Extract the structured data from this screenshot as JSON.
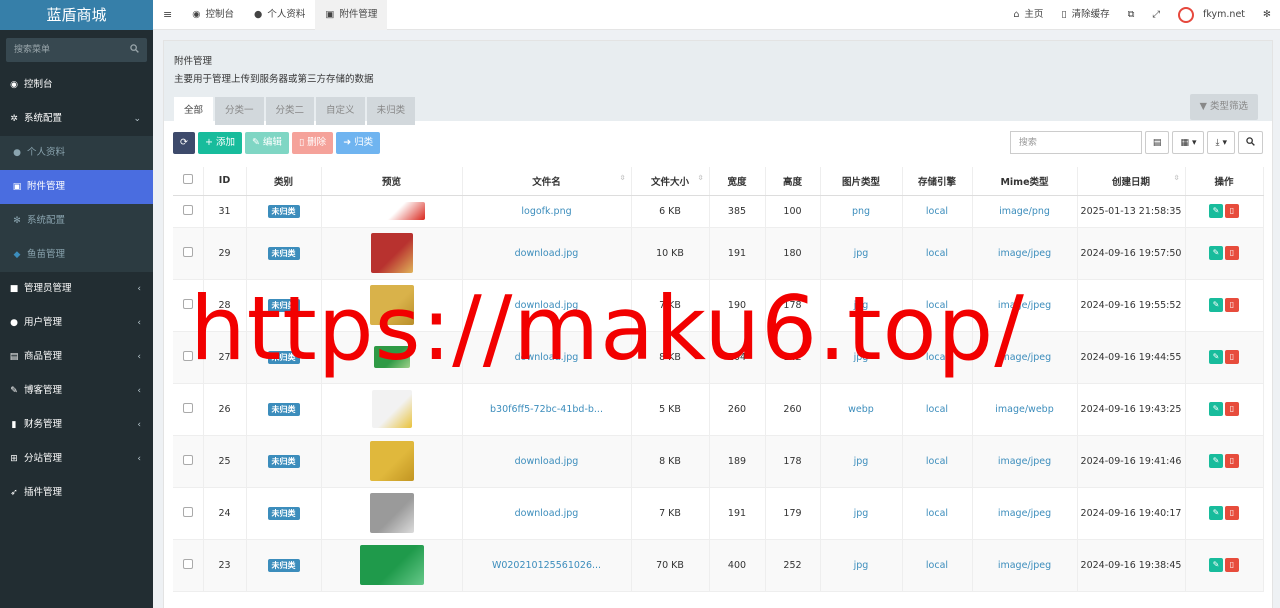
{
  "app": {
    "title": "蓝盾商城"
  },
  "sidebar": {
    "search_placeholder": "搜索菜单",
    "items": [
      {
        "label": "控制台",
        "icon": "dashboard-icon"
      },
      {
        "label": "系统配置",
        "icon": "cogs-icon",
        "expanded": true
      },
      {
        "label": "个人资料",
        "icon": "user-icon",
        "sub": true
      },
      {
        "label": "附件管理",
        "icon": "file-image-icon",
        "sub": true,
        "active": true
      },
      {
        "label": "系统配置",
        "icon": "gear-icon",
        "sub": true
      },
      {
        "label": "鱼苗管理",
        "icon": "fish-icon",
        "sub": true
      },
      {
        "label": "管理员管理",
        "icon": "group-icon"
      },
      {
        "label": "用户管理",
        "icon": "user-icon"
      },
      {
        "label": "商品管理",
        "icon": "shop-icon"
      },
      {
        "label": "博客管理",
        "icon": "blog-icon"
      },
      {
        "label": "财务管理",
        "icon": "book-icon"
      },
      {
        "label": "分站管理",
        "icon": "sitemap-icon"
      },
      {
        "label": "插件管理",
        "icon": "rocket-icon"
      }
    ]
  },
  "topbar": {
    "tabs": [
      {
        "label": "控制台",
        "icon": "dashboard-icon"
      },
      {
        "label": "个人资料",
        "icon": "user-icon"
      },
      {
        "label": "附件管理",
        "icon": "file-image-icon",
        "active": true
      }
    ],
    "home": "主页",
    "clear_cache": "清除缓存",
    "username": "fkym.net"
  },
  "panel": {
    "title": "附件管理",
    "description": "主要用于管理上传到服务器或第三方存储的数据",
    "category_tabs": [
      "全部",
      "分类一",
      "分类二",
      "自定义",
      "未归类"
    ],
    "type_filter": "类型筛选"
  },
  "toolbar": {
    "add": "添加",
    "edit": "编辑",
    "delete": "删除",
    "classify": "归类",
    "search_placeholder": "搜索"
  },
  "table": {
    "headers": [
      "ID",
      "类别",
      "预览",
      "文件名",
      "文件大小",
      "宽度",
      "高度",
      "图片类型",
      "存储引擎",
      "Mime类型",
      "创建日期",
      "操作"
    ],
    "rows": [
      {
        "id": "31",
        "category": "未归类",
        "thumb": "logo",
        "filename": "logofk.png",
        "size": "6 KB",
        "width": "385",
        "height": "100",
        "imagetype": "png",
        "storage": "local",
        "mime": "image/png",
        "created": "2025-01-13 21:58:35"
      },
      {
        "id": "29",
        "category": "未归类",
        "thumb": "red",
        "filename": "download.jpg",
        "size": "10 KB",
        "width": "191",
        "height": "180",
        "imagetype": "jpg",
        "storage": "local",
        "mime": "image/jpeg",
        "created": "2024-09-16 19:57:50"
      },
      {
        "id": "28",
        "category": "未归类",
        "thumb": "gold",
        "filename": "download.jpg",
        "size": "7 KB",
        "width": "190",
        "height": "178",
        "imagetype": "jpg",
        "storage": "local",
        "mime": "image/jpeg",
        "created": "2024-09-16 19:55:52"
      },
      {
        "id": "27",
        "category": "未归类",
        "thumb": "green",
        "filename": "download.jpg",
        "size": "8 KB",
        "width": "204",
        "height": "142",
        "imagetype": "jpg",
        "storage": "local",
        "mime": "image/jpeg",
        "created": "2024-09-16 19:44:55"
      },
      {
        "id": "26",
        "category": "未归类",
        "thumb": "yellow",
        "filename": "b30f6ff5-72bc-41bd-b...",
        "size": "5 KB",
        "width": "260",
        "height": "260",
        "imagetype": "webp",
        "storage": "local",
        "mime": "image/webp",
        "created": "2024-09-16 19:43:25"
      },
      {
        "id": "25",
        "category": "未归类",
        "thumb": "gold2",
        "filename": "download.jpg",
        "size": "8 KB",
        "width": "189",
        "height": "178",
        "imagetype": "jpg",
        "storage": "local",
        "mime": "image/jpeg",
        "created": "2024-09-16 19:41:46"
      },
      {
        "id": "24",
        "category": "未归类",
        "thumb": "silver",
        "filename": "download.jpg",
        "size": "7 KB",
        "width": "191",
        "height": "179",
        "imagetype": "jpg",
        "storage": "local",
        "mime": "image/jpeg",
        "created": "2024-09-16 19:40:17"
      },
      {
        "id": "23",
        "category": "未归类",
        "thumb": "green2",
        "filename": "W020210125561026...",
        "size": "70 KB",
        "width": "400",
        "height": "252",
        "imagetype": "jpg",
        "storage": "local",
        "mime": "image/jpeg",
        "created": "2024-09-16 19:38:45"
      }
    ]
  },
  "watermark": "https://maku6.top/",
  "colors": {
    "sidebar_bg": "#222d32",
    "logo_bg": "#367fa9",
    "active_menu": "#4a6de0",
    "link": "#3c8dbc",
    "success": "#18bc9c",
    "danger": "#e74c3c",
    "watermark": "#f20000"
  }
}
